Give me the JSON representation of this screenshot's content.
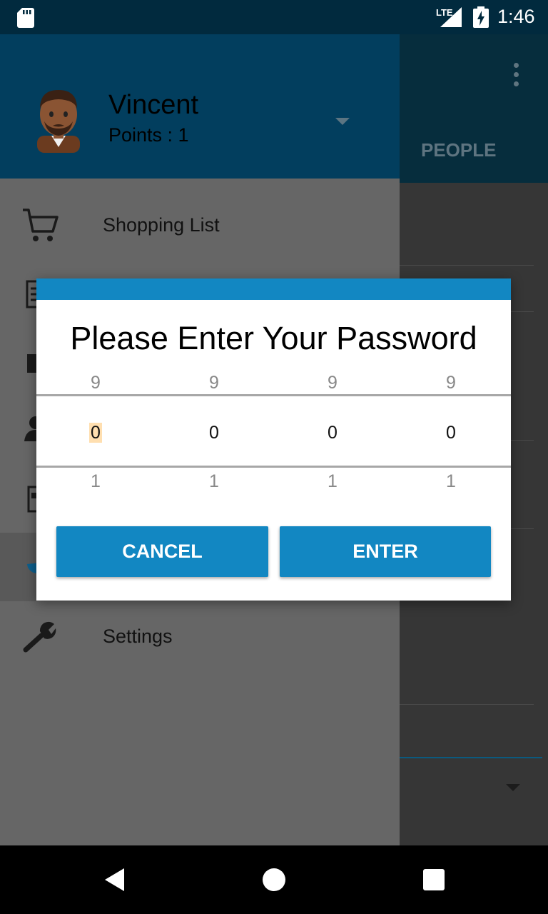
{
  "status_bar": {
    "network": "LTE",
    "time": "1:46"
  },
  "background_app": {
    "tab_label": "PEOPLE",
    "icons": [
      "overflow-menu-icon",
      "dropdown-arrow-icon"
    ]
  },
  "drawer": {
    "user": {
      "name": "Vincent",
      "points": "Points : 1"
    },
    "items": [
      {
        "label": "Shopping List",
        "icon": "shopping-cart-icon"
      },
      {
        "label": "Settings",
        "icon": "wrench-icon"
      }
    ]
  },
  "dialog": {
    "title": "Please Enter Your Password",
    "digits": [
      {
        "prev": "9",
        "current": "0",
        "next": "1"
      },
      {
        "prev": "9",
        "current": "0",
        "next": "1"
      },
      {
        "prev": "9",
        "current": "0",
        "next": "1"
      },
      {
        "prev": "9",
        "current": "0",
        "next": "1"
      }
    ],
    "cancel_label": "CANCEL",
    "enter_label": "ENTER"
  },
  "colors": {
    "accent": "#1287c2",
    "header": "#023e5e",
    "highlight": "#ffdfb0"
  }
}
